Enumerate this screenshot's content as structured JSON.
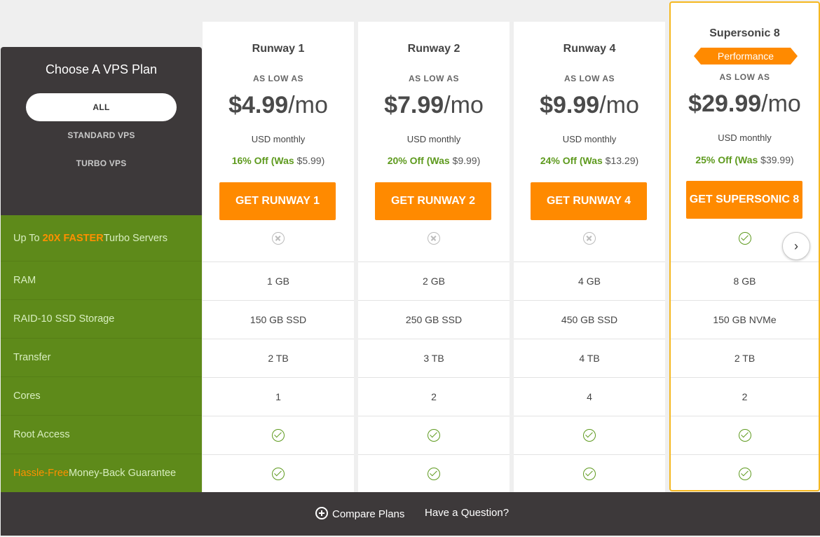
{
  "sidebar": {
    "title": "Choose A VPS Plan",
    "filters": [
      "ALL",
      "STANDARD VPS",
      "TURBO VPS"
    ],
    "features": {
      "turbo": {
        "prefix": "Up To ",
        "highlight": "20X FASTER",
        "suffix": " Turbo Servers"
      },
      "ram": "RAM",
      "storage": "RAID-10 SSD Storage",
      "transfer": "Transfer",
      "cores": "Cores",
      "root": "Root Access",
      "guarantee": {
        "highlight": "Hassle-Free",
        "suffix": " Money-Back Guarantee"
      }
    }
  },
  "plans": [
    {
      "name": "Runway 1",
      "as_low_as": "AS LOW AS",
      "price": "$4.99",
      "per": "/mo",
      "usd": "USD monthly",
      "discount": "16% Off (Was",
      "was": " $5.99)",
      "cta": "GET RUNWAY 1",
      "turbo": "x-icon",
      "ram": "1 GB",
      "storage": "150 GB SSD",
      "transfer": "2 TB",
      "cores": "1",
      "root": "check-icon",
      "guarantee": "check-icon"
    },
    {
      "name": "Runway 2",
      "as_low_as": "AS LOW AS",
      "price": "$7.99",
      "per": "/mo",
      "usd": "USD monthly",
      "discount": "20% Off (Was",
      "was": " $9.99)",
      "cta": "GET RUNWAY 2",
      "turbo": "x-icon",
      "ram": "2 GB",
      "storage": "250 GB SSD",
      "transfer": "3 TB",
      "cores": "2",
      "root": "check-icon",
      "guarantee": "check-icon"
    },
    {
      "name": "Runway 4",
      "as_low_as": "AS LOW AS",
      "price": "$9.99",
      "per": "/mo",
      "usd": "USD monthly",
      "discount": "24% Off (Was",
      "was": " $13.29)",
      "cta": "GET RUNWAY 4",
      "turbo": "x-icon",
      "ram": "4 GB",
      "storage": "450 GB SSD",
      "transfer": "4 TB",
      "cores": "4",
      "root": "check-icon",
      "guarantee": "check-icon"
    },
    {
      "name": "Supersonic 8",
      "badge": "Performance",
      "as_low_as": "AS LOW AS",
      "price": "$29.99",
      "per": "/mo",
      "usd": "USD monthly",
      "discount": "25% Off (Was",
      "was": " $39.99)",
      "cta": "GET SUPERSONIC 8",
      "turbo": "check-icon",
      "ram": "8 GB",
      "storage": "150 GB NVMe",
      "transfer": "2 TB",
      "cores": "2",
      "root": "check-icon",
      "guarantee": "check-icon"
    }
  ],
  "footer": {
    "compare": "Compare Plans",
    "question": "Have a Question?"
  },
  "colors": {
    "accent": "#ff8a00",
    "green": "#5e8a1a",
    "dark": "#3d393a",
    "highlight_border": "#f5b820"
  }
}
